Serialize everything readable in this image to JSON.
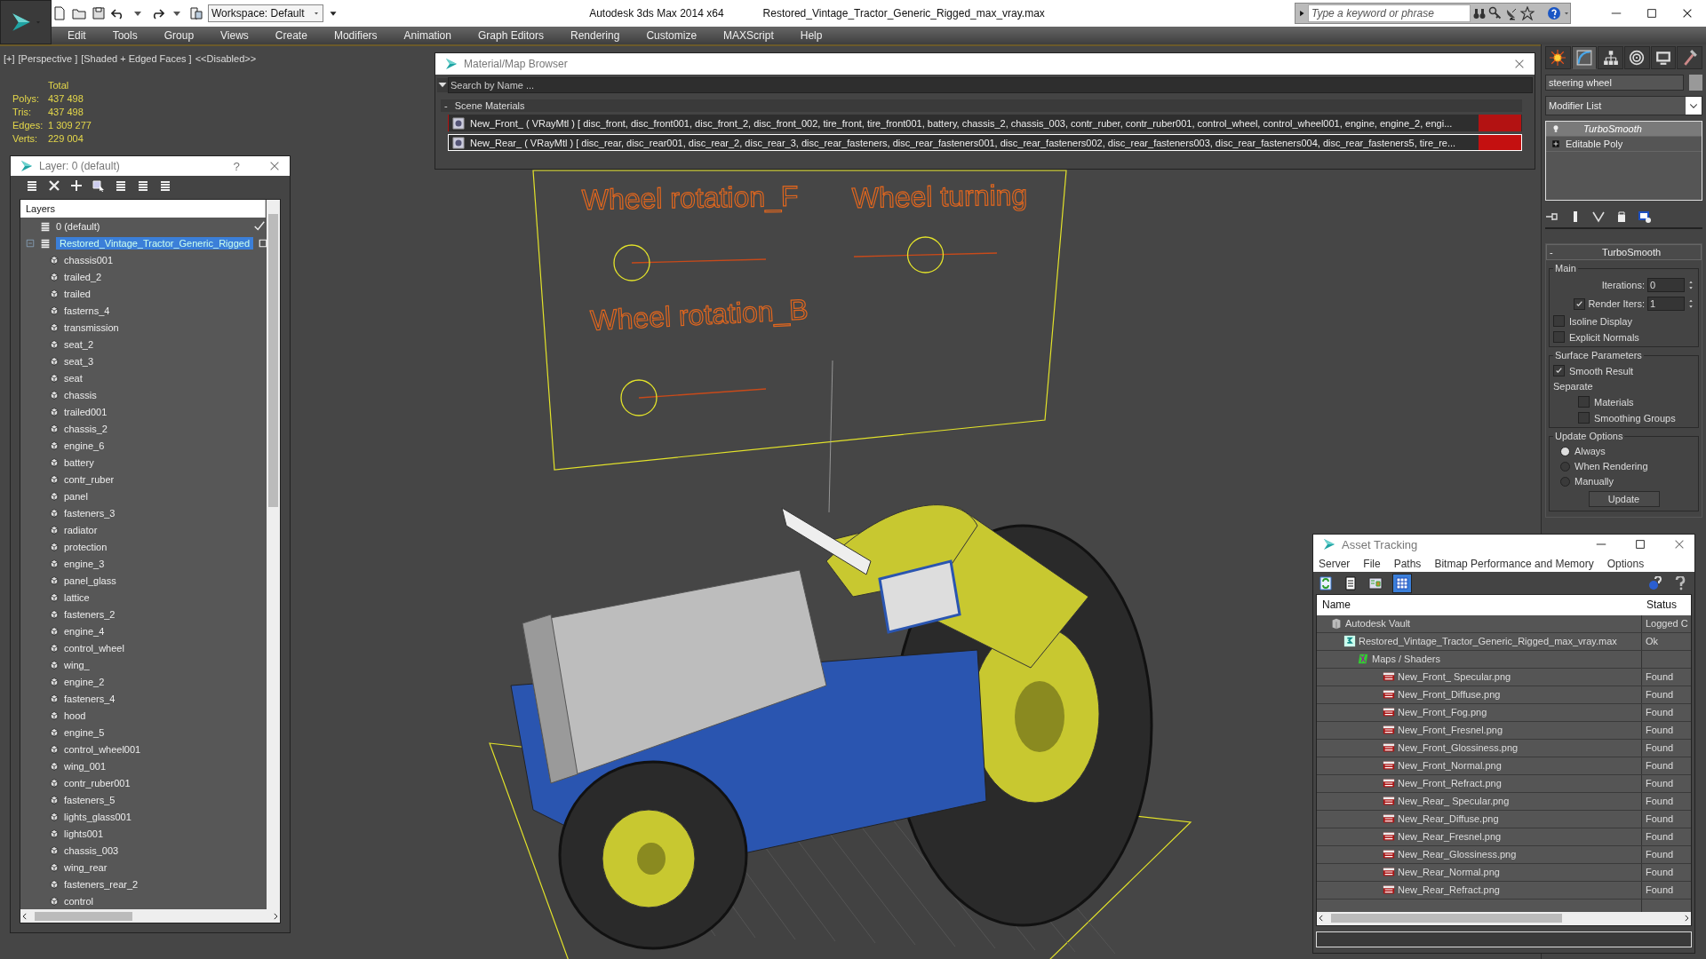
{
  "app": {
    "title": "Autodesk 3ds Max  2014 x64",
    "file": "Restored_Vintage_Tractor_Generic_Rigged_max_vray.max",
    "workspace": "Workspace: Default",
    "search_placeholder": "Type a keyword or phrase"
  },
  "menu": [
    "Edit",
    "Tools",
    "Group",
    "Views",
    "Create",
    "Modifiers",
    "Animation",
    "Graph Editors",
    "Rendering",
    "Customize",
    "MAXScript",
    "Help"
  ],
  "viewport": {
    "labels": [
      "[+]",
      "[Perspective ]",
      "[Shaded + Edged Faces ]",
      "<<Disabled>>"
    ],
    "stats": {
      "header": "Total",
      "rows": [
        {
          "label": "Polys:",
          "value": "437 498"
        },
        {
          "label": "Tris:",
          "value": "437 498"
        },
        {
          "label": "Edges:",
          "value": "1 309 277"
        },
        {
          "label": "Verts:",
          "value": "229 004"
        }
      ]
    },
    "rig_labels": [
      "Wheel rotation_F",
      "Wheel turning",
      "Wheel rotation_B"
    ],
    "rig_sliders": [
      {
        "level": 0
      },
      {
        "level": 0.5
      },
      {
        "level": 0
      }
    ]
  },
  "layer_window": {
    "title": "Layer: 0 (default)",
    "help": "?",
    "column": "Layers",
    "layers": [
      {
        "name": "0 (default)",
        "selected": false,
        "current": true
      },
      {
        "name": "Restored_Vintage_Tractor_Generic_Rigged",
        "selected": true,
        "current": false,
        "children": [
          {
            "name": "chassis001",
            "selected": false
          },
          {
            "name": "trailed_2",
            "selected": false
          },
          {
            "name": "trailed",
            "selected": false
          },
          {
            "name": "fasterns_4",
            "selected": false
          },
          {
            "name": "transmission",
            "selected": false
          },
          {
            "name": "seat_2",
            "selected": false
          },
          {
            "name": "seat_3",
            "selected": false
          },
          {
            "name": "seat",
            "selected": false
          },
          {
            "name": "chassis",
            "selected": false
          },
          {
            "name": "trailed001",
            "selected": false
          },
          {
            "name": "chassis_2",
            "selected": false
          },
          {
            "name": "engine_6",
            "selected": false
          },
          {
            "name": "battery",
            "selected": false
          },
          {
            "name": "contr_ruber",
            "selected": false
          },
          {
            "name": "panel",
            "selected": false
          },
          {
            "name": "fasteners_3",
            "selected": false
          },
          {
            "name": "radiator",
            "selected": false
          },
          {
            "name": "protection",
            "selected": false
          },
          {
            "name": "engine_3",
            "selected": false
          },
          {
            "name": "panel_glass",
            "selected": false
          },
          {
            "name": "lattice",
            "selected": false
          },
          {
            "name": "fasteners_2",
            "selected": false
          },
          {
            "name": "engine_4",
            "selected": false
          },
          {
            "name": "control_wheel",
            "selected": false
          },
          {
            "name": "wing_",
            "selected": false
          },
          {
            "name": "engine_2",
            "selected": false
          },
          {
            "name": "fasteners_4",
            "selected": false
          },
          {
            "name": "hood",
            "selected": false
          },
          {
            "name": "engine_5",
            "selected": false
          },
          {
            "name": "control_wheel001",
            "selected": false
          },
          {
            "name": "wing_001",
            "selected": false
          },
          {
            "name": "contr_ruber001",
            "selected": false
          },
          {
            "name": "fasteners_5",
            "selected": false
          },
          {
            "name": "lights_glass001",
            "selected": false
          },
          {
            "name": "lights001",
            "selected": false
          },
          {
            "name": "chassis_003",
            "selected": false
          },
          {
            "name": "wing_rear",
            "selected": false
          },
          {
            "name": "fasteners_rear_2",
            "selected": false
          },
          {
            "name": "control",
            "selected": false
          }
        ]
      }
    ]
  },
  "material_browser": {
    "title": "Material/Map Browser",
    "search_placeholder": "Search by Name ...",
    "group": {
      "toggle": "-",
      "title": "Scene Materials"
    },
    "materials": [
      {
        "text": "New_Front_  ( VRayMtl ) [ disc_front,  disc_front001,  disc_front_2,  disc_front_002,  tire_front,  tire_front001, battery, chassis_2, chassis_003, contr_ruber, contr_ruber001, control_wheel, control_wheel001, engine, engine_2, engi...",
        "selected": false
      },
      {
        "text": "New_Rear_  ( VRayMtl ) [ disc_rear,  disc_rear001,  disc_rear_2,  disc_rear_3,  disc_rear_fasteners,  disc_rear_fasteners001,  disc_rear_fasteners002,  disc_rear_fasteners003,  disc_rear_fasteners004,  disc_rear_fasteners5,  tire_re...",
        "selected": true
      }
    ]
  },
  "command_panel": {
    "tabs": [
      {
        "selected": false
      },
      {
        "selected": true
      },
      {
        "selected": false
      },
      {
        "selected": false
      },
      {
        "selected": false
      },
      {
        "selected": false
      }
    ],
    "object_name": "steering wheel",
    "modifier_list": "Modifier List",
    "stack": [
      {
        "name": "TurboSmooth",
        "kind": "modifier",
        "selected": true
      },
      {
        "name": "Editable Poly",
        "kind": "base",
        "selected": false
      }
    ],
    "rollout": {
      "toggle": "-",
      "title": "TurboSmooth",
      "main": {
        "title": "Main",
        "iterations_label": "Iterations:",
        "iterations": "0",
        "render_iters": {
          "label": "Render Iters:",
          "checked": true,
          "value": "1"
        },
        "options": [
          {
            "label": "Isoline Display",
            "checked": false
          },
          {
            "label": "Explicit Normals",
            "checked": false
          }
        ]
      },
      "surface": {
        "title": "Surface Parameters",
        "smooth_result": {
          "label": "Smooth Result",
          "checked": true
        },
        "separate": "Separate",
        "options": [
          {
            "label": "Materials",
            "checked": false
          },
          {
            "label": "Smoothing Groups",
            "checked": false
          }
        ]
      },
      "update": {
        "title": "Update Options",
        "options": [
          {
            "label": "Always",
            "selected": true
          },
          {
            "label": "When Rendering",
            "selected": false
          },
          {
            "label": "Manually",
            "selected": false
          }
        ],
        "button": "Update"
      }
    }
  },
  "asset_tracking": {
    "title": "Asset Tracking",
    "menu": [
      "Server",
      "File",
      "Paths",
      "Bitmap Performance and Memory",
      "Options"
    ],
    "toolbar": [
      {
        "selected": false
      },
      {
        "selected": false
      },
      {
        "selected": false
      },
      {
        "selected": true
      }
    ],
    "columns": [
      "Name",
      "Status"
    ],
    "rows": [
      {
        "name": "Autodesk Vault",
        "status": "Logged C",
        "kind": "vault",
        "children": [
          {
            "name": "Restored_Vintage_Tractor_Generic_Rigged_max_vray.max",
            "status": "Ok",
            "kind": "file",
            "children": [
              {
                "name": "Maps / Shaders",
                "kind": "folder",
                "children": [
                  {
                    "name": "New_Front_ Specular.png",
                    "status": "Found",
                    "kind": "png"
                  },
                  {
                    "name": "New_Front_Diffuse.png",
                    "status": "Found",
                    "kind": "png"
                  },
                  {
                    "name": "New_Front_Fog.png",
                    "status": "Found",
                    "kind": "png"
                  },
                  {
                    "name": "New_Front_Fresnel.png",
                    "status": "Found",
                    "kind": "png"
                  },
                  {
                    "name": "New_Front_Glossiness.png",
                    "status": "Found",
                    "kind": "png"
                  },
                  {
                    "name": "New_Front_Normal.png",
                    "status": "Found",
                    "kind": "png"
                  },
                  {
                    "name": "New_Front_Refract.png",
                    "status": "Found",
                    "kind": "png"
                  },
                  {
                    "name": "New_Rear_ Specular.png",
                    "status": "Found",
                    "kind": "png"
                  },
                  {
                    "name": "New_Rear_Diffuse.png",
                    "status": "Found",
                    "kind": "png"
                  },
                  {
                    "name": "New_Rear_Fresnel.png",
                    "status": "Found",
                    "kind": "png"
                  },
                  {
                    "name": "New_Rear_Glossiness.png",
                    "status": "Found",
                    "kind": "png"
                  },
                  {
                    "name": "New_Rear_Normal.png",
                    "status": "Found",
                    "kind": "png"
                  },
                  {
                    "name": "New_Rear_Refract.png",
                    "status": "Found",
                    "kind": "png"
                  }
                ]
              }
            ]
          }
        ]
      }
    ]
  }
}
